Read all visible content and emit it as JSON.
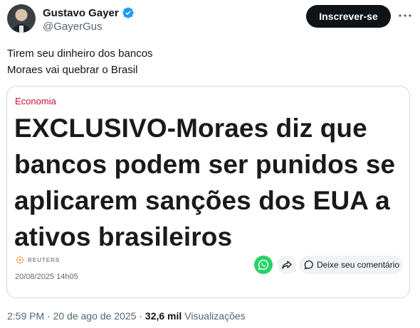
{
  "author": {
    "display_name": "Gustavo Gayer",
    "handle": "@GayerGus",
    "verified": true
  },
  "actions": {
    "subscribe_label": "Inscrever-se",
    "more_icon": "more-horizontal-icon"
  },
  "tweet": {
    "lines": [
      "Tirem seu dinheiro dos bancos",
      "Moraes vai quebrar o Brasil"
    ]
  },
  "card": {
    "category": "Economia",
    "headline_lines": [
      "EXCLUSIVO-Moraes diz que",
      "bancos podem ser punidos se",
      "aplicarem sanções dos EUA a",
      "ativos brasileiros"
    ],
    "source": "REUTERS",
    "date": "20/08/2025 14h05",
    "comment_label": "Deixe seu comentário",
    "category_color": "#c8102e",
    "whatsapp_color": "#25d366"
  },
  "footer": {
    "timestamp": "2:59 PM · 20 de ago de 2025 · ",
    "views_count": "32,6 mil",
    "views_label": "Visualizações"
  }
}
